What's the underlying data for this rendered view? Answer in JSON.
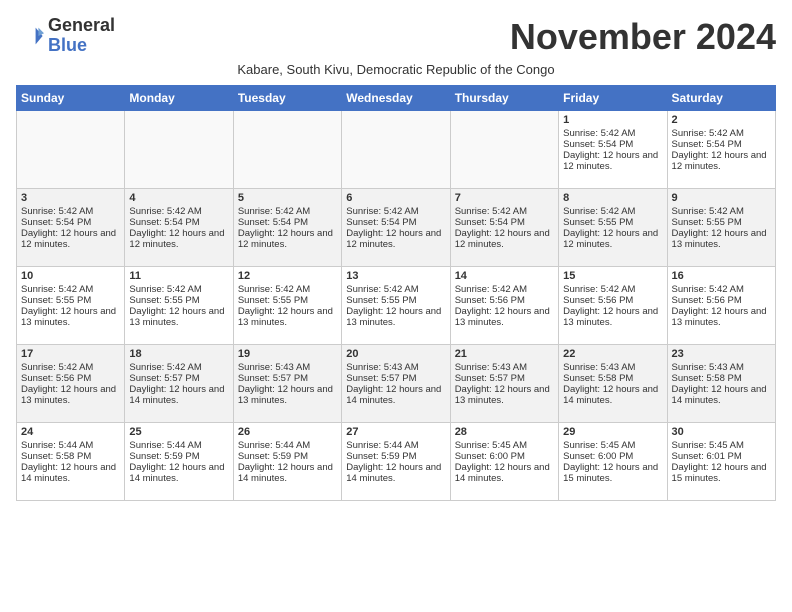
{
  "logo": {
    "general": "General",
    "blue": "Blue"
  },
  "header": {
    "month_title": "November 2024",
    "subtitle": "Kabare, South Kivu, Democratic Republic of the Congo"
  },
  "weekdays": [
    "Sunday",
    "Monday",
    "Tuesday",
    "Wednesday",
    "Thursday",
    "Friday",
    "Saturday"
  ],
  "weeks": [
    [
      {
        "day": "",
        "content": ""
      },
      {
        "day": "",
        "content": ""
      },
      {
        "day": "",
        "content": ""
      },
      {
        "day": "",
        "content": ""
      },
      {
        "day": "",
        "content": ""
      },
      {
        "day": "1",
        "content": "Sunrise: 5:42 AM\nSunset: 5:54 PM\nDaylight: 12 hours and 12 minutes."
      },
      {
        "day": "2",
        "content": "Sunrise: 5:42 AM\nSunset: 5:54 PM\nDaylight: 12 hours and 12 minutes."
      }
    ],
    [
      {
        "day": "3",
        "content": "Sunrise: 5:42 AM\nSunset: 5:54 PM\nDaylight: 12 hours and 12 minutes."
      },
      {
        "day": "4",
        "content": "Sunrise: 5:42 AM\nSunset: 5:54 PM\nDaylight: 12 hours and 12 minutes."
      },
      {
        "day": "5",
        "content": "Sunrise: 5:42 AM\nSunset: 5:54 PM\nDaylight: 12 hours and 12 minutes."
      },
      {
        "day": "6",
        "content": "Sunrise: 5:42 AM\nSunset: 5:54 PM\nDaylight: 12 hours and 12 minutes."
      },
      {
        "day": "7",
        "content": "Sunrise: 5:42 AM\nSunset: 5:54 PM\nDaylight: 12 hours and 12 minutes."
      },
      {
        "day": "8",
        "content": "Sunrise: 5:42 AM\nSunset: 5:55 PM\nDaylight: 12 hours and 12 minutes."
      },
      {
        "day": "9",
        "content": "Sunrise: 5:42 AM\nSunset: 5:55 PM\nDaylight: 12 hours and 13 minutes."
      }
    ],
    [
      {
        "day": "10",
        "content": "Sunrise: 5:42 AM\nSunset: 5:55 PM\nDaylight: 12 hours and 13 minutes."
      },
      {
        "day": "11",
        "content": "Sunrise: 5:42 AM\nSunset: 5:55 PM\nDaylight: 12 hours and 13 minutes."
      },
      {
        "day": "12",
        "content": "Sunrise: 5:42 AM\nSunset: 5:55 PM\nDaylight: 12 hours and 13 minutes."
      },
      {
        "day": "13",
        "content": "Sunrise: 5:42 AM\nSunset: 5:55 PM\nDaylight: 12 hours and 13 minutes."
      },
      {
        "day": "14",
        "content": "Sunrise: 5:42 AM\nSunset: 5:56 PM\nDaylight: 12 hours and 13 minutes."
      },
      {
        "day": "15",
        "content": "Sunrise: 5:42 AM\nSunset: 5:56 PM\nDaylight: 12 hours and 13 minutes."
      },
      {
        "day": "16",
        "content": "Sunrise: 5:42 AM\nSunset: 5:56 PM\nDaylight: 12 hours and 13 minutes."
      }
    ],
    [
      {
        "day": "17",
        "content": "Sunrise: 5:42 AM\nSunset: 5:56 PM\nDaylight: 12 hours and 13 minutes."
      },
      {
        "day": "18",
        "content": "Sunrise: 5:42 AM\nSunset: 5:57 PM\nDaylight: 12 hours and 14 minutes."
      },
      {
        "day": "19",
        "content": "Sunrise: 5:43 AM\nSunset: 5:57 PM\nDaylight: 12 hours and 13 minutes."
      },
      {
        "day": "20",
        "content": "Sunrise: 5:43 AM\nSunset: 5:57 PM\nDaylight: 12 hours and 14 minutes."
      },
      {
        "day": "21",
        "content": "Sunrise: 5:43 AM\nSunset: 5:57 PM\nDaylight: 12 hours and 13 minutes."
      },
      {
        "day": "22",
        "content": "Sunrise: 5:43 AM\nSunset: 5:58 PM\nDaylight: 12 hours and 14 minutes."
      },
      {
        "day": "23",
        "content": "Sunrise: 5:43 AM\nSunset: 5:58 PM\nDaylight: 12 hours and 14 minutes."
      }
    ],
    [
      {
        "day": "24",
        "content": "Sunrise: 5:44 AM\nSunset: 5:58 PM\nDaylight: 12 hours and 14 minutes."
      },
      {
        "day": "25",
        "content": "Sunrise: 5:44 AM\nSunset: 5:59 PM\nDaylight: 12 hours and 14 minutes."
      },
      {
        "day": "26",
        "content": "Sunrise: 5:44 AM\nSunset: 5:59 PM\nDaylight: 12 hours and 14 minutes."
      },
      {
        "day": "27",
        "content": "Sunrise: 5:44 AM\nSunset: 5:59 PM\nDaylight: 12 hours and 14 minutes."
      },
      {
        "day": "28",
        "content": "Sunrise: 5:45 AM\nSunset: 6:00 PM\nDaylight: 12 hours and 14 minutes."
      },
      {
        "day": "29",
        "content": "Sunrise: 5:45 AM\nSunset: 6:00 PM\nDaylight: 12 hours and 15 minutes."
      },
      {
        "day": "30",
        "content": "Sunrise: 5:45 AM\nSunset: 6:01 PM\nDaylight: 12 hours and 15 minutes."
      }
    ]
  ]
}
